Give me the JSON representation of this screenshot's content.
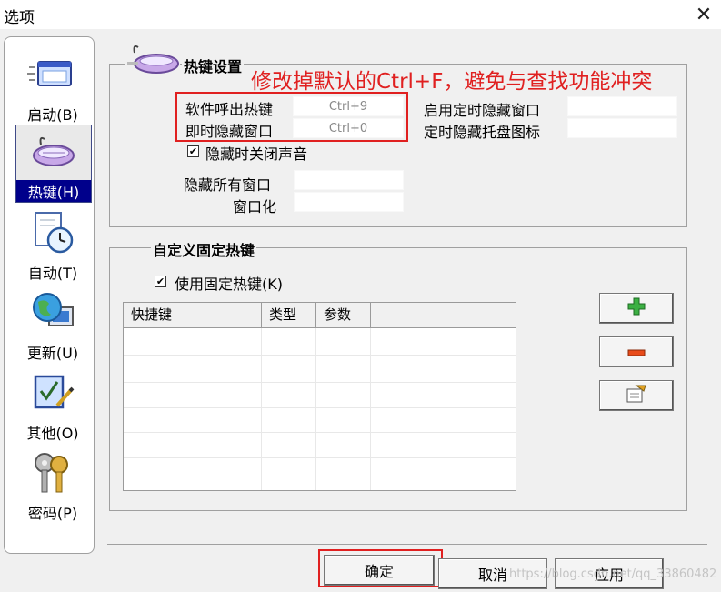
{
  "window": {
    "title": "选项",
    "close_glyph": "✕"
  },
  "sidebar": {
    "items": [
      {
        "label": "启动(B)",
        "icon": "window-icon",
        "active": false
      },
      {
        "label": "热键(H)",
        "icon": "keyboard-icon",
        "active": true
      },
      {
        "label": "自动(T)",
        "icon": "clock-document-icon",
        "active": false
      },
      {
        "label": "更新(U)",
        "icon": "globe-computer-icon",
        "active": false
      },
      {
        "label": "其他(O)",
        "icon": "checklist-pen-icon",
        "active": false
      },
      {
        "label": "密码(P)",
        "icon": "keys-icon",
        "active": false
      }
    ]
  },
  "hotkeys": {
    "legend": "热键设置",
    "software_hotkey_label": "软件呼出热键",
    "software_hotkey_value": "Ctrl+9",
    "hide_window_label": "即时隐藏窗口",
    "hide_window_value": "Ctrl+0",
    "timed_hide_label": "启用定时隐藏窗口",
    "timed_hide_tray_label": "定时隐藏托盘图标",
    "mute_on_hide_label": "隐藏时关闭声音",
    "mute_on_hide_checked": true,
    "hide_all_label": "隐藏所有窗口",
    "windowize_label": "窗口化"
  },
  "annotation": {
    "text": "修改掉默认的Ctrl+F，避免与查找功能冲突",
    "color": "#e02020"
  },
  "custom_hotkeys": {
    "legend": "自定义固定热键",
    "use_fixed_label": "使用固定热键(K)",
    "use_fixed_checked": true,
    "columns": [
      "快捷键",
      "类型",
      "参数"
    ],
    "rows": []
  },
  "side_buttons": {
    "add_icon": "plus-icon",
    "remove_icon": "minus-icon",
    "edit_icon": "edit-properties-icon"
  },
  "footer": {
    "ok_label": "确定",
    "cancel_label": "取消",
    "apply_label": "应用",
    "watermark": "https://blog.csdn.net/qq_33860482"
  }
}
